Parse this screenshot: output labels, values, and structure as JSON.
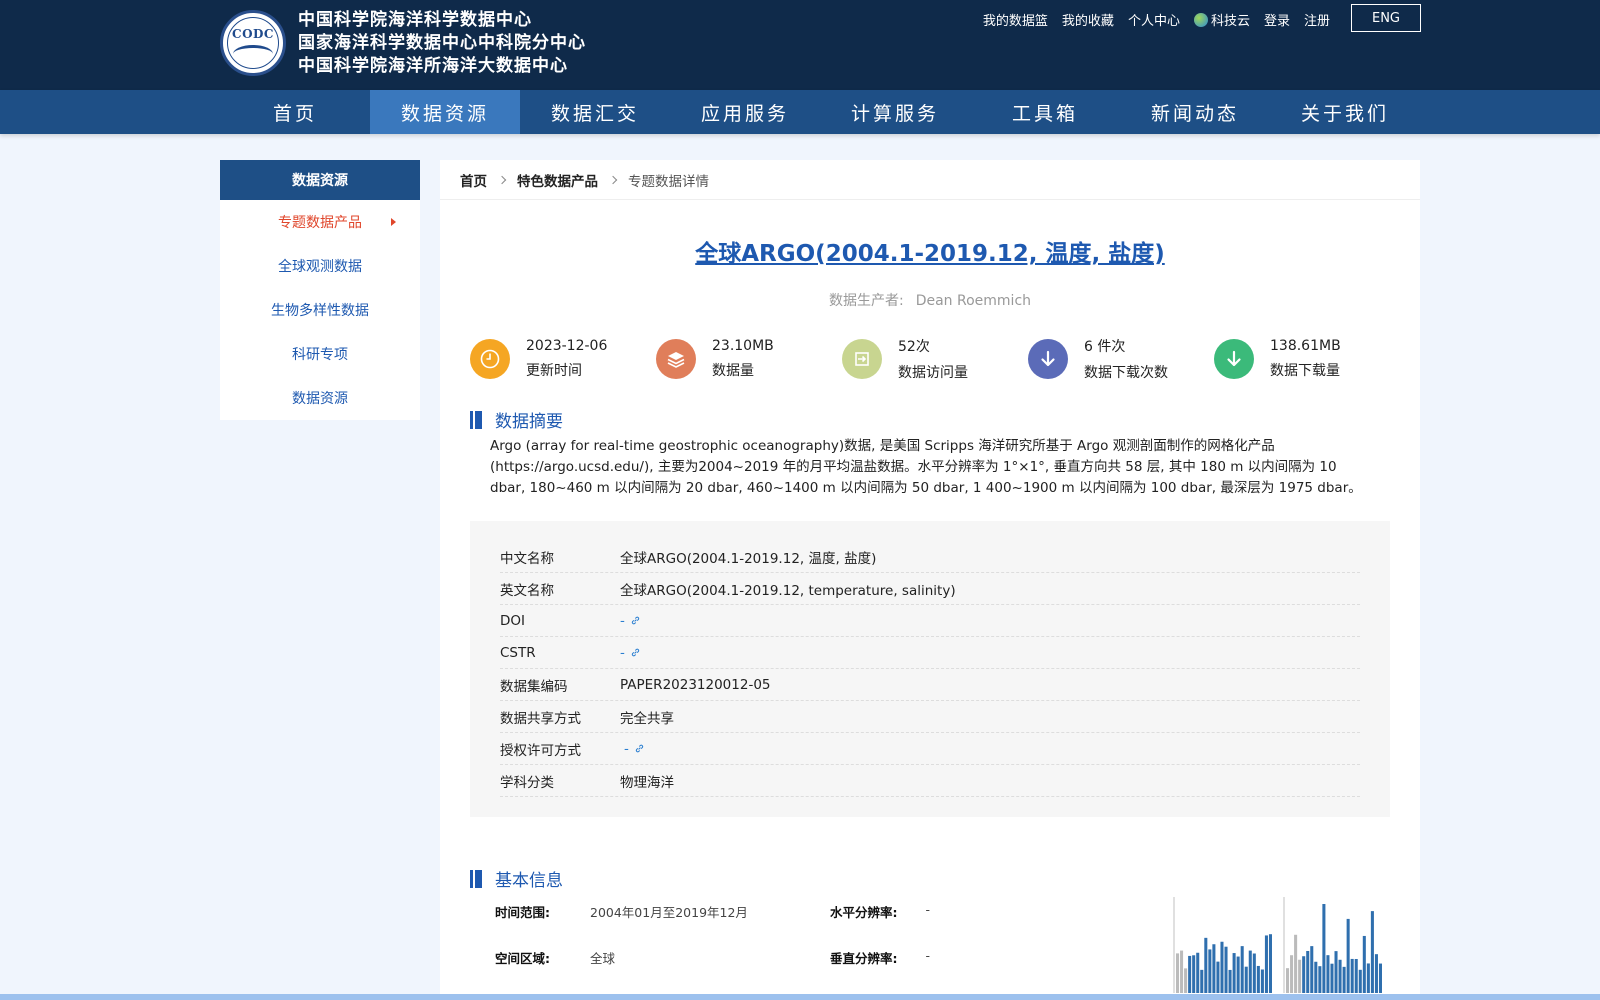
{
  "header": {
    "logo_seal_text": "CODC",
    "logo_lines": [
      "中国科学院海洋科学数据中心",
      "国家海洋科学数据中心中科院分中心",
      "中国科学院海洋所海洋大数据中心"
    ],
    "links": [
      "我的数据篮",
      "我的收藏",
      "个人中心",
      "科技云",
      "登录",
      "注册"
    ],
    "lang_button": "ENG"
  },
  "nav": {
    "items": [
      "首页",
      "数据资源",
      "数据汇交",
      "应用服务",
      "计算服务",
      "工具箱",
      "新闻动态",
      "关于我们"
    ],
    "active_index": 1
  },
  "sidebar": {
    "title": "数据资源",
    "items": [
      "专题数据产品",
      "全球观测数据",
      "生物多样性数据",
      "科研专项",
      "数据资源"
    ],
    "active_index": 0
  },
  "breadcrumb": [
    "首页",
    "特色数据产品",
    "专题数据详情"
  ],
  "dataset": {
    "title": "全球ARGO(2004.1-2019.12, 温度, 盐度)",
    "producer_label": "数据生产者:",
    "producer": "Dean Roemmich"
  },
  "stats": [
    {
      "value": "2023-12-06",
      "label": "更新时间",
      "icon": "clock-icon",
      "color": "#f5a623"
    },
    {
      "value": "23.10MB",
      "label": "数据量",
      "icon": "layers-icon",
      "color": "#e07e5a"
    },
    {
      "value": "52次",
      "label": "数据访问量",
      "icon": "enter-icon",
      "color": "#c8d590"
    },
    {
      "value": "6 件次",
      "label": "数据下载次数",
      "icon": "download-icon",
      "color": "#5b6bb8"
    },
    {
      "value": "138.61MB",
      "label": "数据下载量",
      "icon": "download-icon",
      "color": "#3bba7a"
    }
  ],
  "abstract": {
    "title": "数据摘要",
    "text": "Argo (array for real-time geostrophic oceanography)数据, 是美国 Scripps 海洋研究所基于 Argo 观测剖面制作的网格化产品 (https://argo.ucsd.edu/), 主要为2004~2019 年的月平均温盐数据。水平分辨率为 1°×1°, 垂直方向共 58 层, 其中 180 m 以内间隔为 10 dbar, 180~460 m 以内间隔为 20 dbar, 460~1400 m 以内间隔为 50 dbar, 1 400~1900 m 以内间隔为 100 dbar, 最深层为 1975 dbar。"
  },
  "meta": [
    {
      "key": "中文名称",
      "value": "全球ARGO(2004.1-2019.12, 温度, 盐度)"
    },
    {
      "key": "英文名称",
      "value": "全球ARGO(2004.1-2019.12, temperature, salinity)"
    },
    {
      "key": "DOI",
      "value": "-",
      "link": true
    },
    {
      "key": "CSTR",
      "value": "-",
      "link": true
    },
    {
      "key": "数据集编码",
      "value": "PAPER2023120012-05"
    },
    {
      "key": "数据共享方式",
      "value": "完全共享"
    },
    {
      "key": "授权许可方式",
      "value": "-",
      "link": true
    },
    {
      "key": "学科分类",
      "value": "物理海洋"
    }
  ],
  "basic": {
    "title": "基本信息",
    "time_range_label": "时间范围:",
    "time_range": "2004年01月至2019年12月",
    "horizontal_res_label": "水平分辨率:",
    "horizontal_res": "-",
    "spatial_label": "空间区域:",
    "spatial": "全球",
    "vertical_res_label": "垂直分辨率:",
    "vertical_res": "-"
  },
  "colors": {
    "header_bg": "#0f2a4a",
    "nav_bg": "#1e4f86",
    "nav_active": "#3a78bd",
    "link_blue": "#1e59b0",
    "active_red": "#e0462b"
  }
}
